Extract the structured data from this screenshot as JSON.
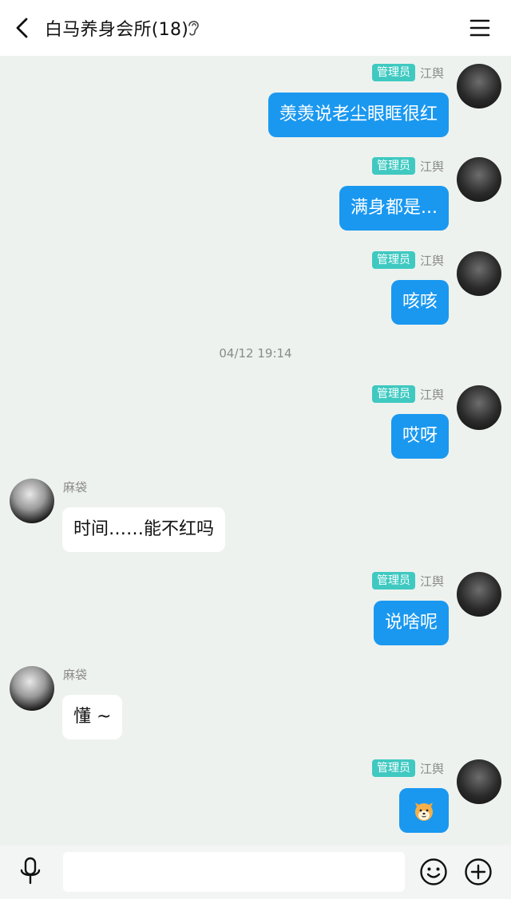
{
  "header": {
    "title": "白马养身会所(18)",
    "back_icon": "back-chevron-icon",
    "ear_icon": "ear-icon",
    "menu_icon": "hamburger-menu-icon"
  },
  "messages": [
    {
      "side": "me",
      "badge": "管理员",
      "name": "江舆",
      "text": "羡羡说老尘眼眶很红"
    },
    {
      "side": "me",
      "badge": "管理员",
      "name": "江舆",
      "text": "满身都是..."
    },
    {
      "side": "me",
      "badge": "管理员",
      "name": "江舆",
      "text": "咳咳"
    },
    {
      "timestamp": "04/12 19:14"
    },
    {
      "side": "me",
      "badge": "管理员",
      "name": "江舆",
      "text": "哎呀"
    },
    {
      "side": "other",
      "name": "麻袋",
      "text": "时间……能不红吗"
    },
    {
      "side": "me",
      "badge": "管理员",
      "name": "江舆",
      "text": "说啥呢"
    },
    {
      "side": "other",
      "name": "麻袋",
      "text": "懂 ~"
    },
    {
      "side": "me",
      "badge": "管理员",
      "name": "江舆",
      "text": "",
      "emoji": "shiba-dog-emoji"
    }
  ],
  "input": {
    "placeholder": "",
    "mic_icon": "microphone-icon",
    "emoji_icon": "smiley-face-icon",
    "plus_icon": "plus-circle-icon"
  },
  "colors": {
    "background": "#edf2ee",
    "my_bubble": "#1a98f0",
    "admin_badge": "#3fc9c1",
    "other_bubble": "#ffffff"
  }
}
